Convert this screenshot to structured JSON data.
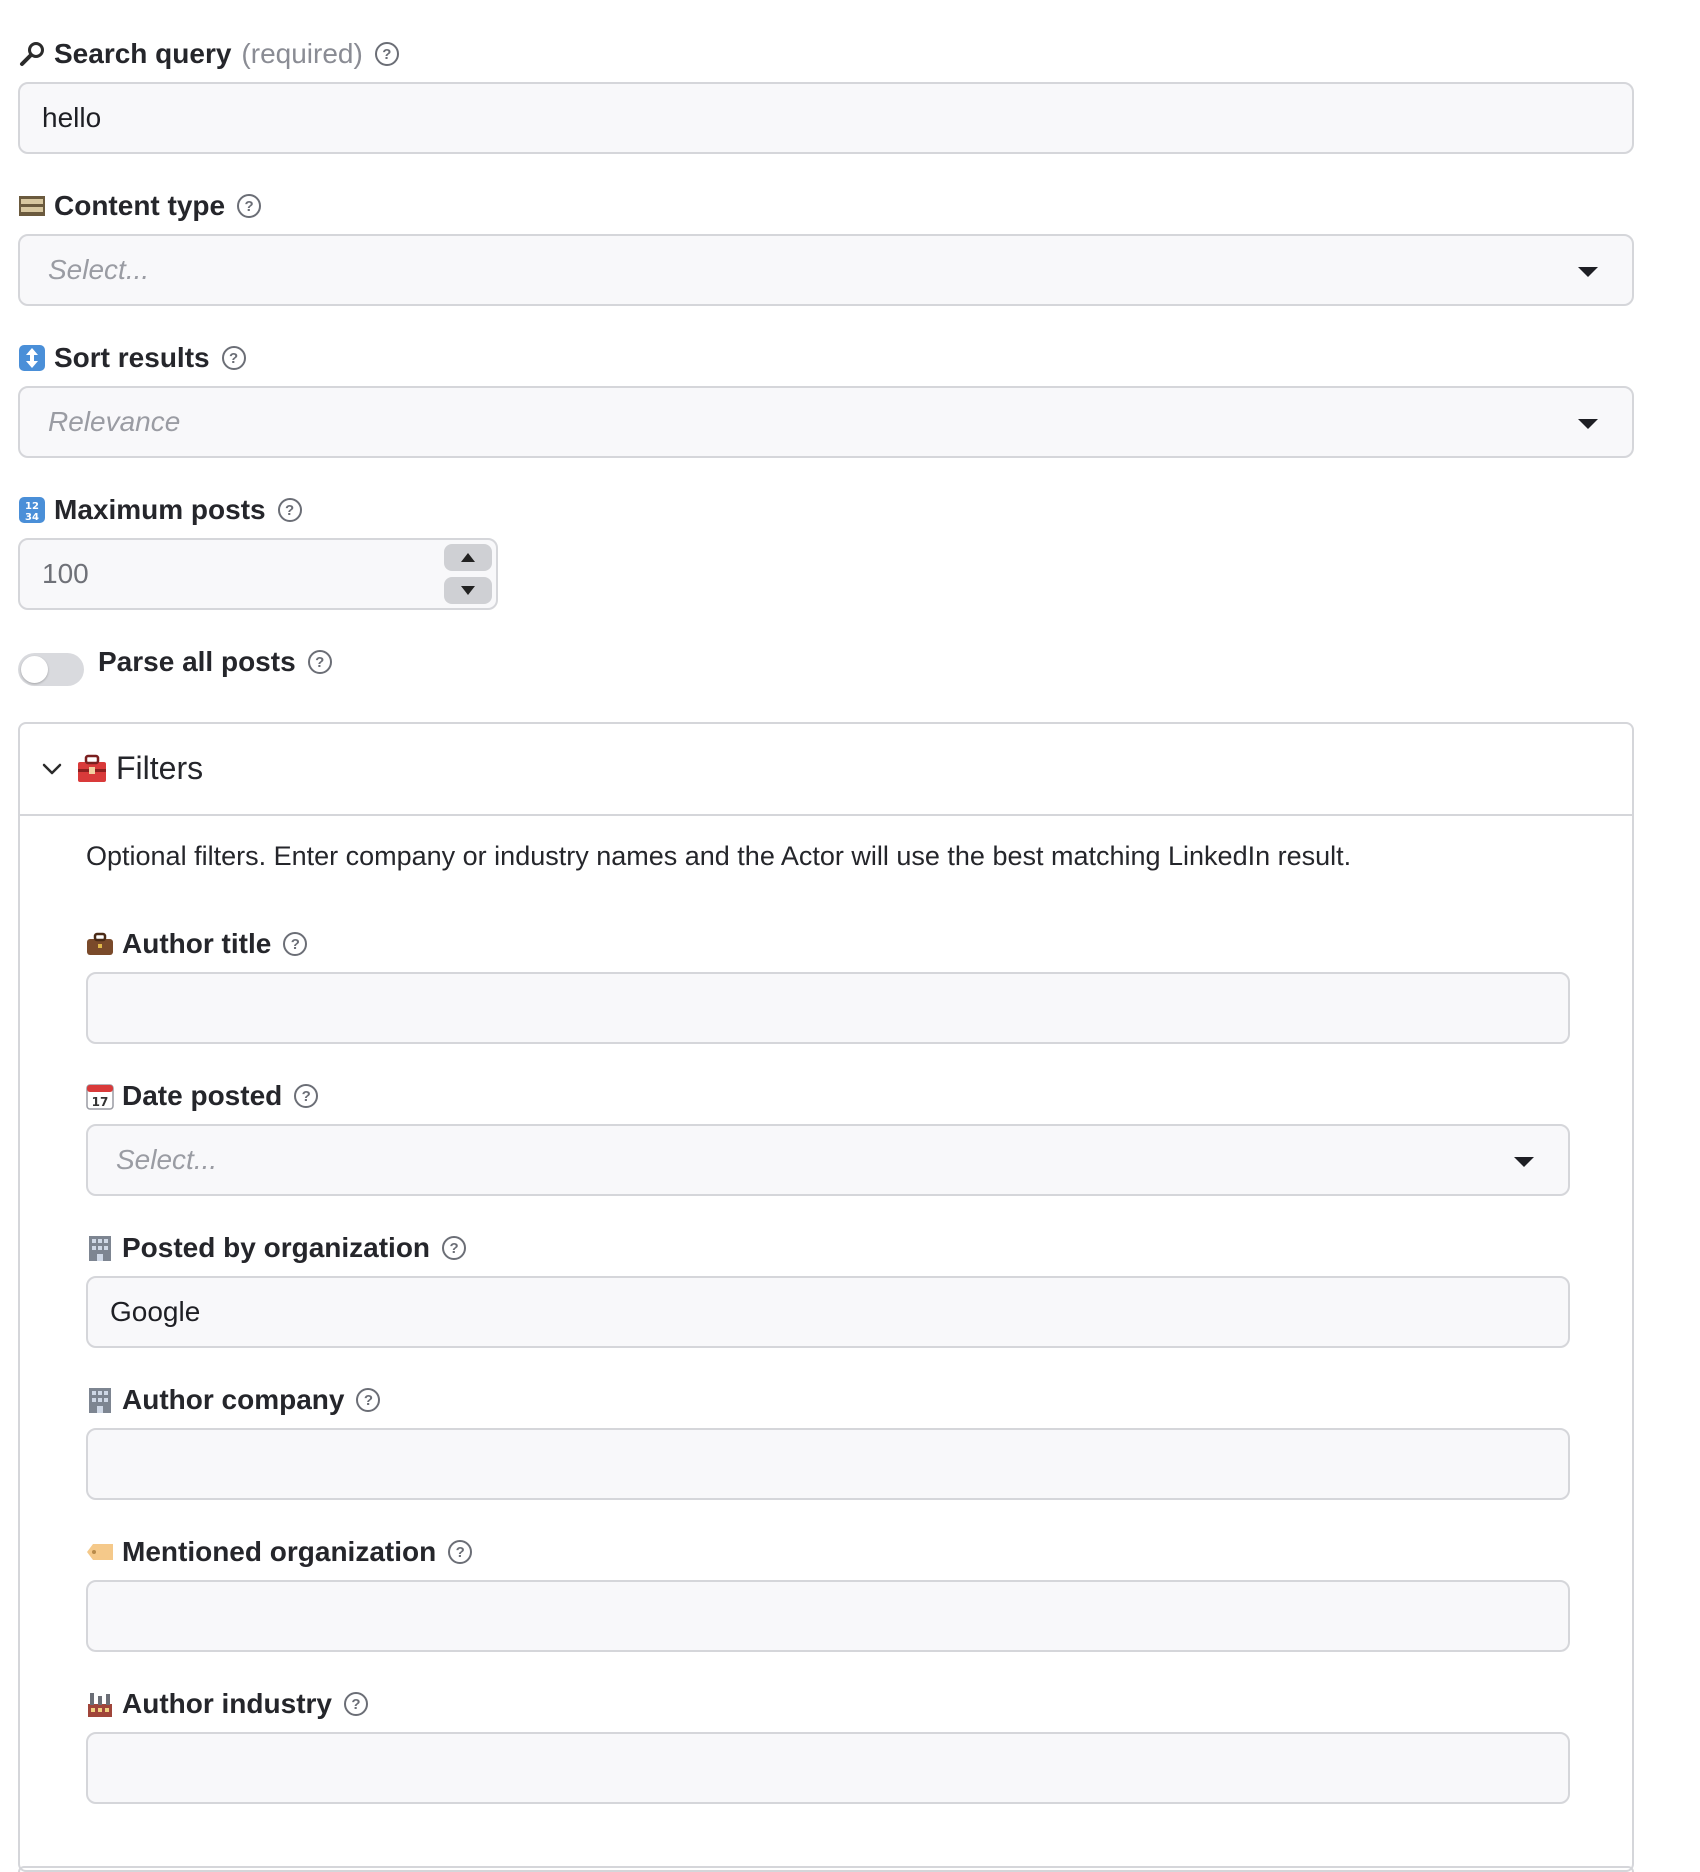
{
  "search_query": {
    "label": "Search query",
    "required_tag": "(required)",
    "value": "hello",
    "icon": "magnifier-icon"
  },
  "content_type": {
    "label": "Content type",
    "placeholder": "Select...",
    "icon": "film-frames-icon"
  },
  "sort_results": {
    "label": "Sort results",
    "placeholder": "Relevance",
    "icon": "up-down-arrow-icon"
  },
  "maximum_posts": {
    "label": "Maximum posts",
    "value": "100",
    "icon": "numbers-1234-icon"
  },
  "parse_all_posts": {
    "label": "Parse all posts",
    "enabled": false
  },
  "filters": {
    "title": "Filters",
    "icon": "toolbox-icon",
    "expanded": true,
    "description": "Optional filters. Enter company or industry names and the Actor will use the best matching LinkedIn result.",
    "author_title": {
      "label": "Author title",
      "value": "",
      "icon": "briefcase-icon"
    },
    "date_posted": {
      "label": "Date posted",
      "placeholder": "Select...",
      "icon": "calendar-icon"
    },
    "posted_by_org": {
      "label": "Posted by organization",
      "value": "Google",
      "icon": "office-building-icon"
    },
    "author_company": {
      "label": "Author company",
      "value": "",
      "icon": "office-building-icon"
    },
    "mentioned_org": {
      "label": "Mentioned organization",
      "value": "",
      "icon": "label-tag-icon"
    },
    "author_industry": {
      "label": "Author industry",
      "value": "",
      "icon": "factory-icon"
    }
  },
  "colors": {
    "field_bg": "#f8f8fa",
    "field_border": "#d5d6da",
    "text": "#25262b",
    "placeholder": "#9a9ca3",
    "toggle_off": "#d9dade"
  }
}
